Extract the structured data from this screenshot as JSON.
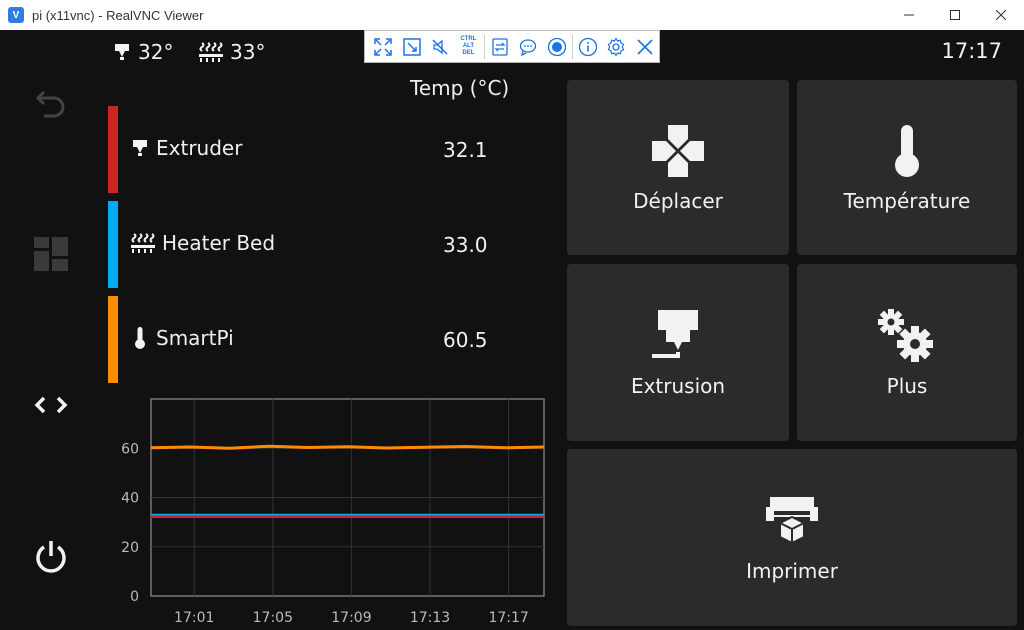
{
  "window": {
    "title": "pi (x11vnc) - RealVNC Viewer",
    "app_icon_text": "V"
  },
  "status": {
    "extruder_temp": "32°",
    "bed_temp": "33°",
    "time": "17:17"
  },
  "table": {
    "header": "Temp (°C)",
    "rows": [
      {
        "name": "Extruder",
        "value": "32.1",
        "color": "#c62828",
        "icon": "extruder-icon"
      },
      {
        "name": "Heater Bed",
        "value": "33.0",
        "color": "#03a9f4",
        "icon": "heater-bed-icon"
      },
      {
        "name": "SmartPi",
        "value": "60.5",
        "color": "#ff8c00",
        "icon": "thermometer-icon"
      }
    ]
  },
  "chart_data": {
    "type": "line",
    "x_ticks": [
      "17:01",
      "17:05",
      "17:09",
      "17:13",
      "17:17"
    ],
    "y_ticks": [
      "0",
      "20",
      "40",
      "60"
    ],
    "ylim": [
      0,
      80
    ],
    "grid": true,
    "series": [
      {
        "color": "#ff8c00",
        "values": [
          60.2,
          60.5,
          60.0,
          60.8,
          60.3,
          60.6,
          60.1,
          60.4,
          60.7,
          60.2,
          60.5
        ]
      },
      {
        "color": "#03a9f4",
        "values": [
          33.0,
          33.0,
          33.0,
          33.0,
          33.0,
          33.0,
          33.0,
          33.0,
          33.0,
          33.0,
          33.0
        ]
      },
      {
        "color": "#c62828",
        "values": [
          32.1,
          32.1,
          32.1,
          32.1,
          32.1,
          32.1,
          32.1,
          32.1,
          32.1,
          32.1,
          32.1
        ]
      }
    ]
  },
  "tiles": {
    "move": "Déplacer",
    "temperature": "Température",
    "extrude": "Extrusion",
    "more": "Plus",
    "print": "Imprimer"
  },
  "vnc_toolbar": {
    "ctrl_alt_del": [
      "CTRL",
      "ALT",
      "DEL"
    ]
  }
}
